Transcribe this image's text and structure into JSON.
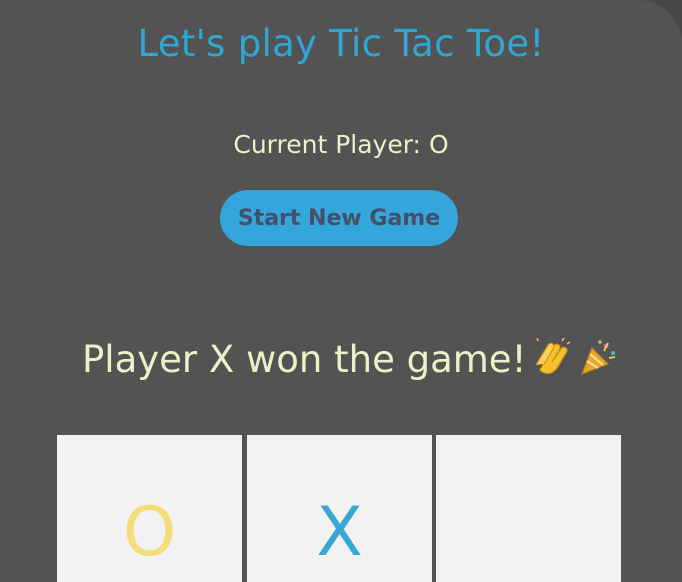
{
  "game": {
    "title": "Let's play Tic Tac Toe!",
    "current_player_label": "Current Player:",
    "current_player_value": "O",
    "new_game_label": "Start New Game",
    "winner_message": "Player X won the game!",
    "winner_emojis": [
      "clapping-hands-icon",
      "party-popper-icon"
    ],
    "board": {
      "cells": [
        "O",
        "X",
        "",
        "",
        "",
        "",
        "",
        "",
        ""
      ]
    }
  },
  "colors": {
    "background": "#535353",
    "title": "#2fa6d3",
    "text": "#eef0c7",
    "button": "#35a6dc",
    "button_text": "#444f6a",
    "cell": "#f2f2f2",
    "o_mark": "#f3dd78",
    "x_mark": "#37a8d6"
  }
}
